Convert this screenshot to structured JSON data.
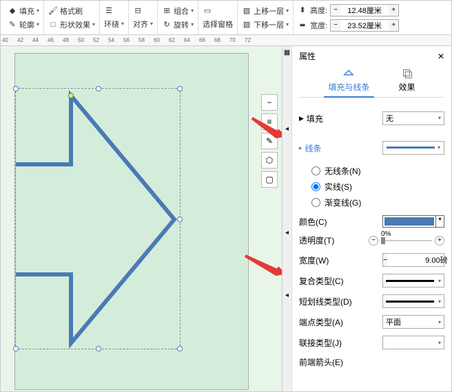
{
  "toolbar": {
    "fill": "填充",
    "format_painter": "格式刷",
    "outline": "轮廓",
    "shape_effects": "形状效果",
    "wrap": "环绕",
    "align": "对齐",
    "group": "组合",
    "rotate": "旋转",
    "select_pane": "选择窗格",
    "bring_forward": "上移一层",
    "send_backward": "下移一层",
    "height_label": "高度:",
    "width_label": "宽度:",
    "height_value": "12.48厘米",
    "width_value": "23.52厘米"
  },
  "ruler": {
    "marks": [
      "40",
      "42",
      "44",
      "46",
      "48",
      "50",
      "52",
      "54",
      "56",
      "58",
      "60",
      "62",
      "64",
      "66",
      "68",
      "70",
      "72"
    ]
  },
  "panel": {
    "title": "属性",
    "tabs": {
      "fill_line": "填充与线条",
      "effects": "效果"
    },
    "fill": {
      "header": "填充",
      "value": "无"
    },
    "line": {
      "header": "线条",
      "options": {
        "none": "无线条(N)",
        "solid": "实线(S)",
        "gradient": "渐变线(G)"
      },
      "selected": "solid"
    },
    "props": {
      "color": "颜色(C)",
      "transparency": "透明度(T)",
      "transparency_value": "0%",
      "width": "宽度(W)",
      "width_value": "9.00磅",
      "compound": "复合类型(C)",
      "dash": "短划线类型(D)",
      "cap": "端点类型(A)",
      "cap_value": "平面",
      "join": "联接类型(J)",
      "arrow_head": "前端箭头(E)"
    }
  }
}
